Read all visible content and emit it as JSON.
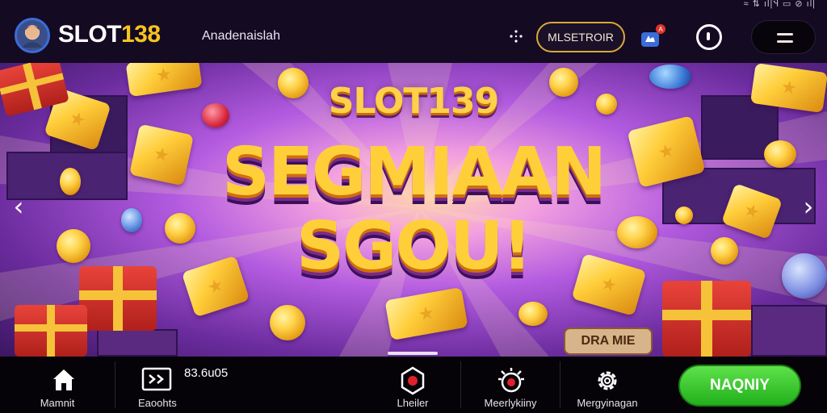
{
  "status_bar": {
    "text": "≈ ⇅ ıl|Ⴣ ▭ ⊘ ıl|"
  },
  "header": {
    "brand_prefix": "SLOT",
    "brand_number": "138",
    "link_label": "Anadenaislah",
    "promo_button_label": "MLSETROIR"
  },
  "banner": {
    "title_small": "SLOT139",
    "title_line1": "SEGMIAAN",
    "title_line2": "SGOU!",
    "sign_label": "DRA MIE",
    "arrow_left": "‹",
    "arrow_right": "›"
  },
  "bottom_nav": {
    "items": [
      {
        "label": "Mamnit",
        "icon": "home-icon"
      },
      {
        "label": "Eaoohts",
        "icon": "terminal-icon"
      },
      {
        "label": "Lheiler",
        "icon": "record-icon"
      },
      {
        "label": "Meerlykiiny",
        "icon": "alarm-icon"
      },
      {
        "label": "Mergyinagan",
        "icon": "gear-icon"
      }
    ],
    "balance": "83.6u05",
    "cta_label": "NAQNIY"
  },
  "colors": {
    "brand_accent": "#f5c41e",
    "cta_green": "#3cc82a",
    "header_bg": "#140a22",
    "banner_purple": "#8a3ec4"
  }
}
